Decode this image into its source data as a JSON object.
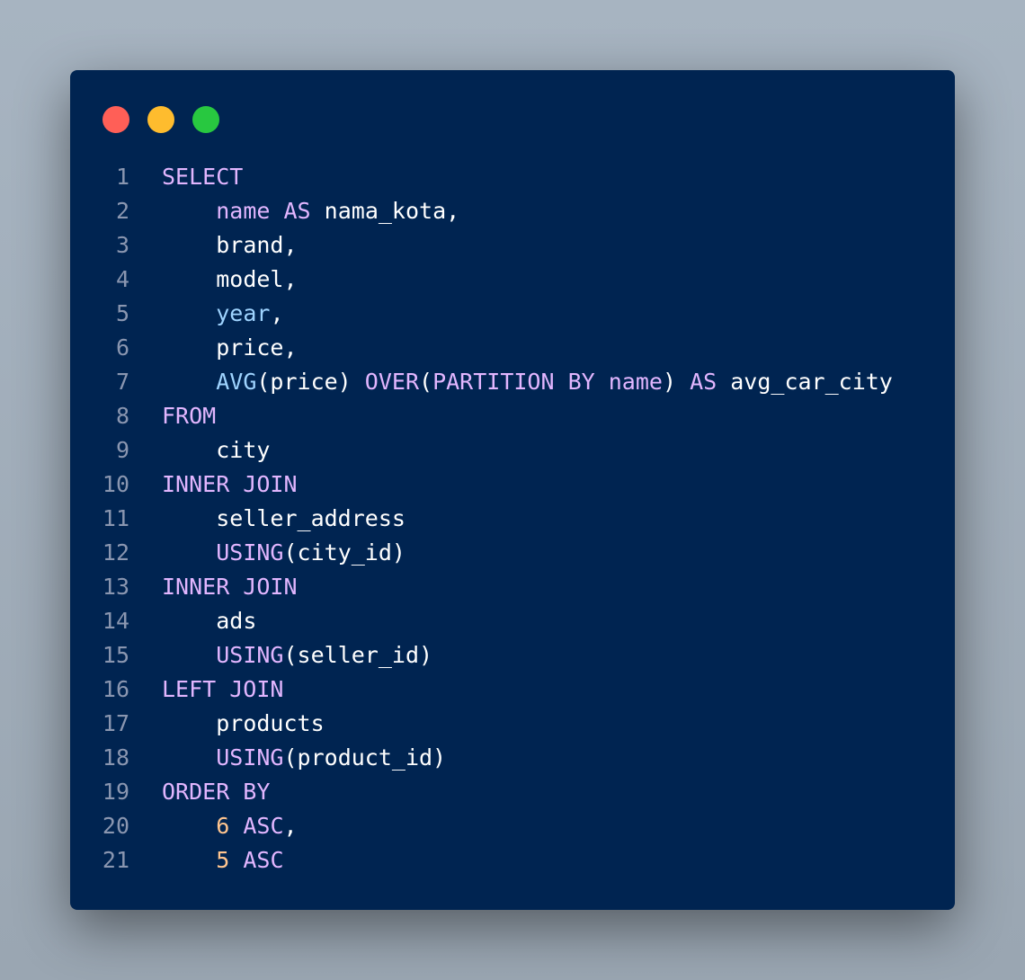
{
  "window": {
    "background": "#002451",
    "traffic_lights": [
      {
        "name": "close",
        "color": "#ff5f57"
      },
      {
        "name": "minimize",
        "color": "#febc2e"
      },
      {
        "name": "maximize",
        "color": "#28c840"
      }
    ]
  },
  "colors": {
    "keyword": "#e2b6ff",
    "function": "#9fd4ff",
    "number": "#ffc58f",
    "identifier": "#ffffff",
    "line_number": "#8a96b0"
  },
  "code": {
    "language": "sql",
    "lines": [
      {
        "num": "1",
        "tokens": [
          {
            "t": "kw",
            "v": "SELECT"
          }
        ]
      },
      {
        "num": "2",
        "tokens": [
          {
            "t": "ws",
            "v": "    "
          },
          {
            "t": "kw",
            "v": "name"
          },
          {
            "t": "ws",
            "v": " "
          },
          {
            "t": "kw",
            "v": "AS"
          },
          {
            "t": "ws",
            "v": " "
          },
          {
            "t": "id",
            "v": "nama_kota,"
          }
        ]
      },
      {
        "num": "3",
        "tokens": [
          {
            "t": "ws",
            "v": "    "
          },
          {
            "t": "id",
            "v": "brand,"
          }
        ]
      },
      {
        "num": "4",
        "tokens": [
          {
            "t": "ws",
            "v": "    "
          },
          {
            "t": "id",
            "v": "model,"
          }
        ]
      },
      {
        "num": "5",
        "tokens": [
          {
            "t": "ws",
            "v": "    "
          },
          {
            "t": "fn",
            "v": "year"
          },
          {
            "t": "id",
            "v": ","
          }
        ]
      },
      {
        "num": "6",
        "tokens": [
          {
            "t": "ws",
            "v": "    "
          },
          {
            "t": "id",
            "v": "price,"
          }
        ]
      },
      {
        "num": "7",
        "tokens": [
          {
            "t": "ws",
            "v": "    "
          },
          {
            "t": "fn",
            "v": "AVG"
          },
          {
            "t": "id",
            "v": "(price) "
          },
          {
            "t": "kw",
            "v": "OVER"
          },
          {
            "t": "id",
            "v": "("
          },
          {
            "t": "kw",
            "v": "PARTITION BY name"
          },
          {
            "t": "id",
            "v": ") "
          },
          {
            "t": "kw",
            "v": "AS"
          },
          {
            "t": "ws",
            "v": " "
          },
          {
            "t": "id",
            "v": "avg_car_city"
          }
        ]
      },
      {
        "num": "8",
        "tokens": [
          {
            "t": "kw",
            "v": "FROM"
          }
        ]
      },
      {
        "num": "9",
        "tokens": [
          {
            "t": "ws",
            "v": "    "
          },
          {
            "t": "id",
            "v": "city"
          }
        ]
      },
      {
        "num": "10",
        "tokens": [
          {
            "t": "kw",
            "v": "INNER JOIN"
          }
        ]
      },
      {
        "num": "11",
        "tokens": [
          {
            "t": "ws",
            "v": "    "
          },
          {
            "t": "id",
            "v": "seller_address"
          }
        ]
      },
      {
        "num": "12",
        "tokens": [
          {
            "t": "ws",
            "v": "    "
          },
          {
            "t": "kw",
            "v": "USING"
          },
          {
            "t": "id",
            "v": "(city_id)"
          }
        ]
      },
      {
        "num": "13",
        "tokens": [
          {
            "t": "kw",
            "v": "INNER JOIN"
          }
        ]
      },
      {
        "num": "14",
        "tokens": [
          {
            "t": "ws",
            "v": "    "
          },
          {
            "t": "id",
            "v": "ads"
          }
        ]
      },
      {
        "num": "15",
        "tokens": [
          {
            "t": "ws",
            "v": "    "
          },
          {
            "t": "kw",
            "v": "USING"
          },
          {
            "t": "id",
            "v": "(seller_id)"
          }
        ]
      },
      {
        "num": "16",
        "tokens": [
          {
            "t": "kw",
            "v": "LEFT JOIN"
          }
        ]
      },
      {
        "num": "17",
        "tokens": [
          {
            "t": "ws",
            "v": "    "
          },
          {
            "t": "id",
            "v": "products"
          }
        ]
      },
      {
        "num": "18",
        "tokens": [
          {
            "t": "ws",
            "v": "    "
          },
          {
            "t": "kw",
            "v": "USING"
          },
          {
            "t": "id",
            "v": "(product_id)"
          }
        ]
      },
      {
        "num": "19",
        "tokens": [
          {
            "t": "kw",
            "v": "ORDER BY"
          }
        ]
      },
      {
        "num": "20",
        "tokens": [
          {
            "t": "ws",
            "v": "    "
          },
          {
            "t": "num",
            "v": "6"
          },
          {
            "t": "ws",
            "v": " "
          },
          {
            "t": "kw",
            "v": "ASC"
          },
          {
            "t": "id",
            "v": ","
          }
        ]
      },
      {
        "num": "21",
        "tokens": [
          {
            "t": "ws",
            "v": "    "
          },
          {
            "t": "num",
            "v": "5"
          },
          {
            "t": "ws",
            "v": " "
          },
          {
            "t": "kw",
            "v": "ASC"
          }
        ]
      }
    ]
  }
}
